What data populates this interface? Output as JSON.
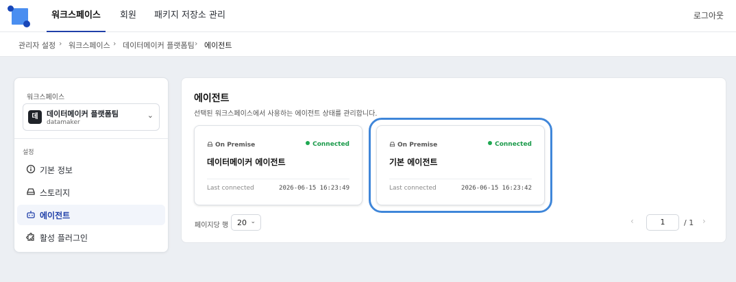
{
  "nav": {
    "tabs": [
      {
        "label": "워크스페이스"
      },
      {
        "label": "회원"
      },
      {
        "label": "패키지 저장소 관리"
      }
    ],
    "logout": "로그아웃"
  },
  "breadcrumb": [
    "관리자 설정",
    "워크스페이스",
    "데이터메이커 플랫폼팀",
    "에이전트"
  ],
  "sidebar": {
    "workspace_label": "워크스페이스",
    "workspace": {
      "avatar": "데",
      "name": "데이터메이커 플랫폼팀",
      "slug": "datamaker"
    },
    "section_label": "설정",
    "items": [
      {
        "label": "기본 정보",
        "icon": "info-icon"
      },
      {
        "label": "스토리지",
        "icon": "storage-icon"
      },
      {
        "label": "에이전트",
        "icon": "agent-icon"
      },
      {
        "label": "활성 플러그인",
        "icon": "plugin-icon"
      }
    ]
  },
  "main": {
    "title": "에이전트",
    "description": "선택된 워크스페이스에서 사용하는 에이전트 상태를 관리합니다.",
    "cards": [
      {
        "type": "On Premise",
        "status": "Connected",
        "name": "데이터메이커 에이전트",
        "last_connected_label": "Last connected",
        "last_connected": "2026-06-15 16:23:49"
      },
      {
        "type": "On Premise",
        "status": "Connected",
        "name": "기본 에이전트",
        "last_connected_label": "Last connected",
        "last_connected": "2026-06-15 16:23:42"
      }
    ],
    "pagination": {
      "per_page_label": "페이지당 행",
      "per_page": "20",
      "page": "1",
      "total": "/ 1"
    }
  },
  "colors": {
    "accent": "#1f3fa8",
    "status_connected": "#1ea851",
    "selection_frame": "#3f86d9"
  }
}
